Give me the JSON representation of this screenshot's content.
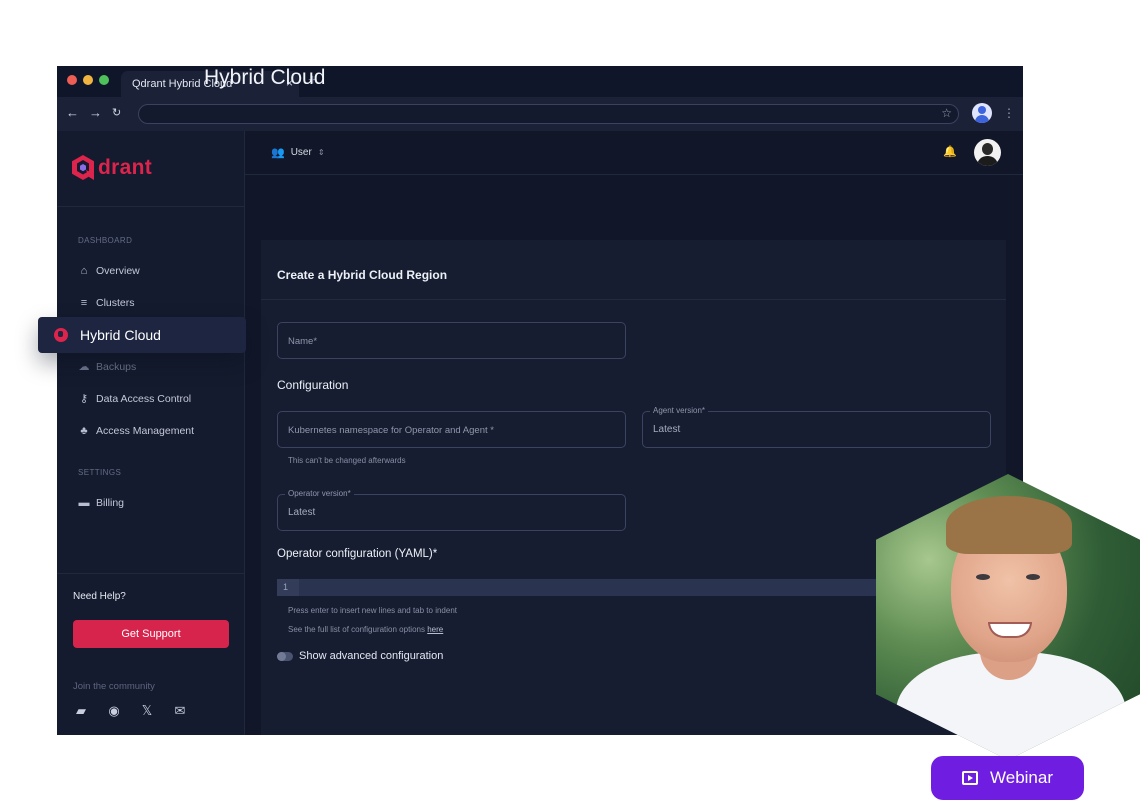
{
  "browser": {
    "tab_title": "Qdrant Hybrid Cloud",
    "tab_close": "×",
    "new_tab": "+",
    "url": "",
    "traffic_colors": [
      "#ee5e55",
      "#f2b441",
      "#4fc15a"
    ]
  },
  "sidebar": {
    "logo_text": "drant",
    "section_dashboard": "DASHBOARD",
    "items": [
      {
        "label": "Overview",
        "icon": "home-icon"
      },
      {
        "label": "Clusters",
        "icon": "list-icon"
      },
      {
        "label": "Hybrid Cloud",
        "icon": "cloud-location-icon",
        "active": true
      },
      {
        "label": "Backups",
        "icon": "cloud-upload-icon"
      },
      {
        "label": "Data Access Control",
        "icon": "key-icon"
      },
      {
        "label": "Access Management",
        "icon": "people-icon"
      }
    ],
    "section_settings": "SETTINGS",
    "settings_items": [
      {
        "label": "Billing",
        "icon": "credit-card-icon"
      }
    ],
    "need_help": "Need Help?",
    "support_button": "Get Support",
    "join_community": "Join the community"
  },
  "topbar": {
    "user_select": "User"
  },
  "main": {
    "page_title": "Hybrid Cloud",
    "card_title": "Create a Hybrid Cloud Region",
    "name_placeholder": "Name*",
    "configuration_heading": "Configuration",
    "namespace_placeholder": "Kubernetes namespace for Operator and Agent *",
    "namespace_hint": "This can't be changed afterwards",
    "agent_version_label": "Agent version*",
    "agent_version_value": "Latest",
    "operator_version_label": "Operator version*",
    "operator_version_value": "Latest",
    "yaml_heading": "Operator configuration (YAML)*",
    "yaml_line_number": "1",
    "yaml_hint_1": "Press enter to insert new lines and tab to indent",
    "yaml_hint_2": "See the full list of configuration options",
    "yaml_hint_link": "here",
    "advanced_toggle_label": "Show advanced configuration"
  },
  "overlay": {
    "active_item_label": "Hybrid Cloud",
    "webinar_label": "Webinar"
  },
  "colors": {
    "brand": "#dc244c",
    "webinar": "#6f1de0",
    "background": "#111729"
  }
}
